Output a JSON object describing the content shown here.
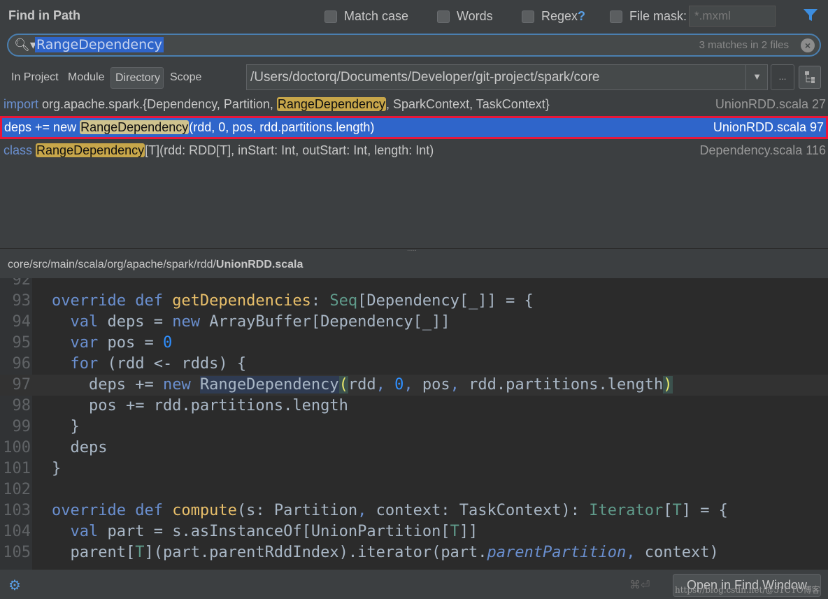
{
  "header": {
    "title": "Find in Path",
    "options": [
      {
        "label": "Match case",
        "checked": false
      },
      {
        "label": "Words",
        "checked": false
      },
      {
        "label": "Regex",
        "checked": false
      },
      {
        "label": "File mask:",
        "checked": false
      }
    ],
    "regex_help": "?",
    "file_mask_placeholder": "*.mxml",
    "filter_icon": "filter-icon"
  },
  "search": {
    "value": "RangeDependency",
    "count": "3 matches in 2 files"
  },
  "scope": {
    "tabs": [
      "In Project",
      "Module",
      "Directory",
      "Scope"
    ],
    "selected": "Directory",
    "path": "/Users/doctorq/Documents/Developer/git-project/spark/core",
    "more": "..."
  },
  "results": [
    {
      "pre_kw": "import",
      "pre": " org.apache.spark.{Dependency, Partition, ",
      "match": "RangeDependency",
      "post": ", SparkContext, TaskContext}",
      "file": "UnionRDD.scala 27"
    },
    {
      "pre_kw": "",
      "pre": "deps += new ",
      "match": "RangeDependency",
      "post": "(rdd, 0, pos, rdd.partitions.length)",
      "file": "UnionRDD.scala 97",
      "selected": true
    },
    {
      "pre_kw": "class",
      "pre": " ",
      "match": "RangeDependency",
      "post": "[T](rdd: RDD[T], inStart: Int, outStart: Int, length: Int)",
      "file": "Dependency.scala 116"
    }
  ],
  "preview": {
    "path_prefix": "core/src/main/scala/org/apache/spark/rdd/",
    "file_name": "UnionRDD.scala"
  },
  "code": [
    {
      "n": "92",
      "t": []
    },
    {
      "n": "93",
      "t": [
        [
          "override def ",
          "kw"
        ],
        [
          "getDependencies",
          "fn"
        ],
        [
          ": ",
          ""
        ],
        [
          "Seq",
          "ty"
        ],
        [
          "[Dependency[_]] = {",
          ""
        ]
      ]
    },
    {
      "n": "94",
      "t": [
        [
          "  val ",
          "kw"
        ],
        [
          "deps = ",
          ""
        ],
        [
          "new ",
          "kw"
        ],
        [
          "ArrayBuffer[Dependency[_]]",
          ""
        ]
      ]
    },
    {
      "n": "95",
      "t": [
        [
          "  var ",
          "kw"
        ],
        [
          "pos = ",
          ""
        ],
        [
          "0",
          "num"
        ]
      ]
    },
    {
      "n": "96",
      "t": [
        [
          "  for ",
          "kw"
        ],
        [
          "(rdd <- rdds) {",
          ""
        ]
      ]
    },
    {
      "n": "97",
      "t": [
        [
          "    deps += ",
          ""
        ],
        [
          "new ",
          "kw"
        ],
        [
          "RangeDependency",
          "id"
        ],
        [
          "(",
          "br"
        ],
        [
          "rdd",
          ""
        ],
        [
          ", ",
          "kw"
        ],
        [
          "0",
          "num"
        ],
        [
          ", ",
          "kw"
        ],
        [
          "pos",
          ""
        ],
        [
          ", ",
          "kw"
        ],
        [
          "rdd.partitions.length",
          ""
        ],
        [
          ")",
          "br"
        ]
      ],
      "current": true
    },
    {
      "n": "98",
      "t": [
        [
          "    pos += rdd.partitions.length",
          ""
        ]
      ]
    },
    {
      "n": "99",
      "t": [
        [
          "  }",
          ""
        ]
      ]
    },
    {
      "n": "100",
      "t": [
        [
          "  deps",
          ""
        ]
      ]
    },
    {
      "n": "101",
      "t": [
        [
          "}",
          ""
        ]
      ]
    },
    {
      "n": "102",
      "t": []
    },
    {
      "n": "103",
      "t": [
        [
          "override def ",
          "kw"
        ],
        [
          "compute",
          "fn"
        ],
        [
          "(s: Partition",
          ""
        ],
        [
          ", ",
          "kw"
        ],
        [
          "context: TaskContext): ",
          ""
        ],
        [
          "Iterator",
          "ty"
        ],
        [
          "[",
          ""
        ],
        [
          "T",
          "ty"
        ],
        [
          "] = {",
          ""
        ]
      ]
    },
    {
      "n": "104",
      "t": [
        [
          "  val ",
          "kw"
        ],
        [
          "part = s.asInstanceOf[UnionPartition[",
          ""
        ],
        [
          "T",
          "ty"
        ],
        [
          "]]",
          ""
        ]
      ]
    },
    {
      "n": "105",
      "t": [
        [
          "  parent[",
          ""
        ],
        [
          "T",
          "ty"
        ],
        [
          "](part.parentRddIndex).iterator(part.",
          ""
        ],
        [
          "parentPartition",
          "it"
        ],
        [
          ", ",
          "kw"
        ],
        [
          "context)",
          ""
        ]
      ]
    }
  ],
  "footer": {
    "shortcut": "⌘⏎",
    "open_button": "Open in Find Window",
    "watermark": "https://blog.csdn.net/@51CTO博客"
  }
}
